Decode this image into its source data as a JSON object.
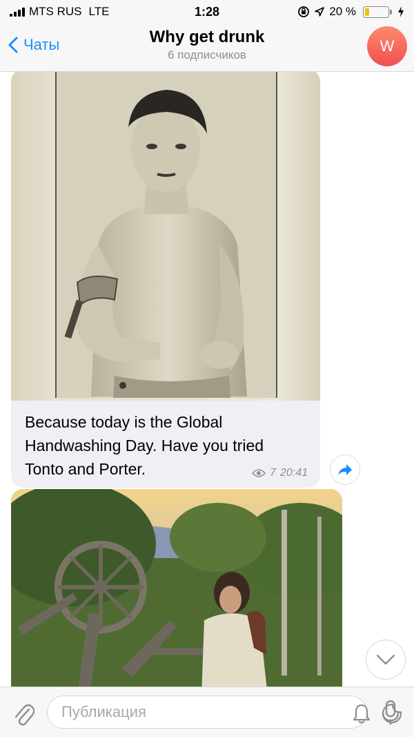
{
  "status_bar": {
    "carrier": "MTS RUS",
    "network": "LTE",
    "time": "1:28",
    "battery_percent": "20 %",
    "battery_level": 0.2,
    "icons": [
      "signal-icon",
      "screen-lock-icon",
      "location-icon",
      "battery-icon",
      "charging-icon"
    ]
  },
  "header": {
    "back_label": "Чаты",
    "title": "Why get drunk",
    "subtitle": "6 подписчиков",
    "avatar_letter": "W",
    "accent_color": "#1a8cff"
  },
  "messages": [
    {
      "type": "photo-with-caption",
      "caption": "Because today is the Global Handwashing Day. Have you tried Tonto and Porter.",
      "views": "7",
      "time": "20:41",
      "icons": [
        "eye-icon",
        "share-icon"
      ]
    },
    {
      "type": "photo"
    }
  ],
  "input": {
    "placeholder": "Публикация",
    "value": "",
    "icons": [
      "paperclip-icon",
      "bell-icon",
      "sticker-icon",
      "microphone-icon"
    ]
  }
}
